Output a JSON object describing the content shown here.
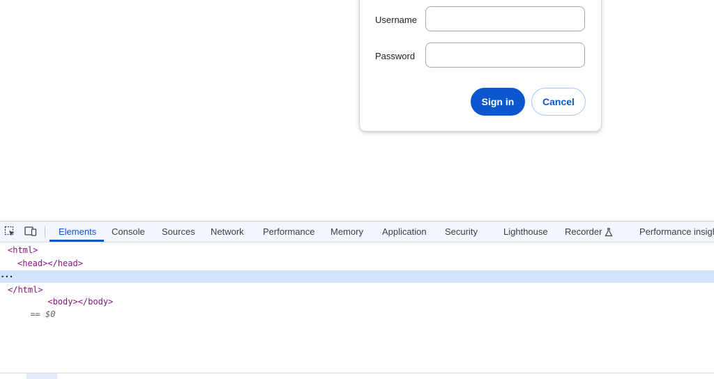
{
  "auth_dialog": {
    "username_label": "Username",
    "username_value": "",
    "password_label": "Password",
    "password_value": "",
    "sign_in_label": "Sign in",
    "cancel_label": "Cancel"
  },
  "devtools": {
    "tabs": [
      {
        "label": "Elements",
        "active": true
      },
      {
        "label": "Console"
      },
      {
        "label": "Sources"
      },
      {
        "label": "Network"
      },
      {
        "label": "Performance"
      },
      {
        "label": "Memory"
      },
      {
        "label": "Application"
      },
      {
        "label": "Security"
      },
      {
        "label": "Lighthouse"
      },
      {
        "label": "Recorder"
      },
      {
        "label": "Performance insights"
      }
    ],
    "dom": {
      "html_open": "<html>",
      "head": "<head></head>",
      "body": "<body></body>",
      "selected_marker": "== $0",
      "html_close": "</html>",
      "ellipsis": "···"
    },
    "icons": [
      "inspect-element-icon",
      "device-toolbar-icon",
      "flask-icon"
    ]
  },
  "colors": {
    "accent": "#0b57d0",
    "selection": "#d3e3fd",
    "tag": "#881280"
  }
}
